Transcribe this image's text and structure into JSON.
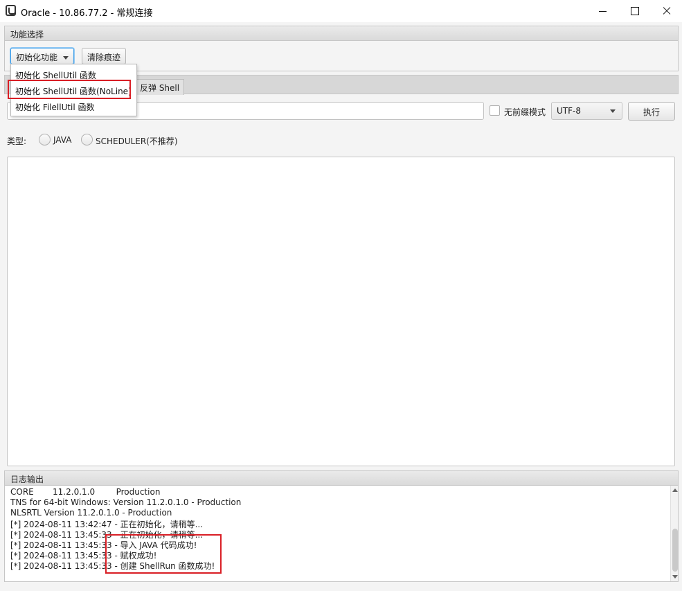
{
  "window": {
    "title": "Oracle - 10.86.77.2 - 常规连接",
    "app_icon": "oracle-app-icon"
  },
  "function_section": {
    "header": "功能选择",
    "init_button_label": "初始化功能",
    "clear_button_label": "清除痕迹",
    "dropdown_items": [
      "初始化 ShellUtil 函数",
      "初始化 ShellUtil 函数(NoLine)",
      "初始化 FilellUtil 函数"
    ]
  },
  "tabs": {
    "visible_tab_label": "反弹 Shell"
  },
  "command": {
    "input_value": "",
    "no_prefix_label": "无前缀模式",
    "no_prefix_checked": false,
    "encoding": "UTF-8",
    "execute_label": "执行"
  },
  "type_row": {
    "label": "类型:",
    "options": [
      "JAVA",
      "SCHEDULER(不推荐)"
    ]
  },
  "log": {
    "header": "日志输出",
    "lines": [
      "CORE\t11.2.0.1.0\tProduction",
      "TNS for 64-bit Windows: Version 11.2.0.1.0 - Production",
      "NLSRTL Version 11.2.0.1.0 - Production",
      "[*] 2024-08-11 13:42:47 - 正在初始化，请稍等...",
      "[*] 2024-08-11 13:45:33 - 正在初始化，请稍等...",
      "[*] 2024-08-11 13:45:33 - 导入 JAVA 代码成功!",
      "[*] 2024-08-11 13:45:33 - 赋权成功!",
      "[*] 2024-08-11 13:45:33 - 创建 ShellRun 函数成功!"
    ]
  },
  "colors": {
    "highlight": "#d91e25",
    "focus": "#3d9ee9"
  }
}
